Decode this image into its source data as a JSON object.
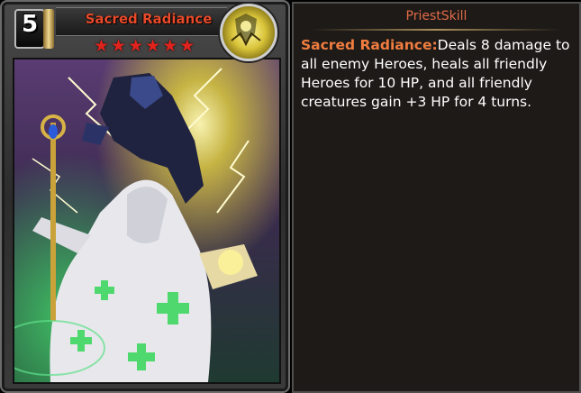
{
  "card": {
    "cost": "5",
    "name": "Sacred Radiance",
    "stars": 6,
    "class_icon": "priest-emblem-icon",
    "colors": {
      "name": "#e84a2a",
      "stars": "#e0231c"
    }
  },
  "tooltip": {
    "title": "PriestSkill",
    "skill_name": "Sacred Radiance:",
    "description": "Deals 8 damage to all enemy Heroes, heals all friendly Heroes for 10 HP, and all friendly creatures gain +3 HP for 4 turns.",
    "colors": {
      "title": "#e06b4a",
      "skill_name": "#f07d3f"
    }
  }
}
